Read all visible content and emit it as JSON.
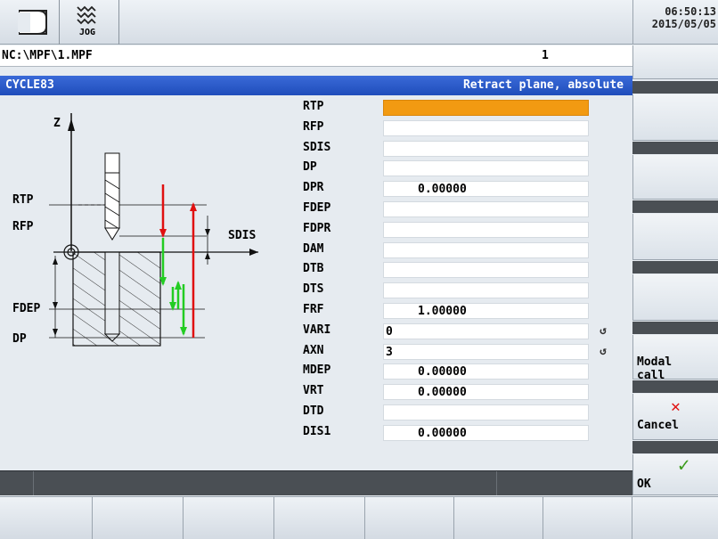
{
  "header": {
    "mode_icon": "jog-icon",
    "mode_label": "JOG",
    "time": "06:50:13",
    "date": "2015/05/05"
  },
  "path": {
    "program": "NC:\\MPF\\1.MPF",
    "channel": "1"
  },
  "cycle": {
    "name": "CYCLE83",
    "hint": "Retract plane, absolute"
  },
  "diagram": {
    "z_label": "Z",
    "rtp": "RTP",
    "rfp": "RFP",
    "sdis": "SDIS",
    "fdep": "FDEP",
    "dp": "DP"
  },
  "params": [
    {
      "name": "RTP",
      "value": "",
      "active": true
    },
    {
      "name": "RFP",
      "value": ""
    },
    {
      "name": "SDIS",
      "value": ""
    },
    {
      "name": "DP",
      "value": ""
    },
    {
      "name": "DPR",
      "value": "0.00000"
    },
    {
      "name": "FDEP",
      "value": ""
    },
    {
      "name": "FDPR",
      "value": ""
    },
    {
      "name": "DAM",
      "value": ""
    },
    {
      "name": "DTB",
      "value": ""
    },
    {
      "name": "DTS",
      "value": ""
    },
    {
      "name": "FRF",
      "value": "1.00000"
    },
    {
      "name": "VARI",
      "value": "0",
      "toggle": true
    },
    {
      "name": "AXN",
      "value": "3",
      "toggle": true
    },
    {
      "name": "MDEP",
      "value": "0.00000"
    },
    {
      "name": "VRT",
      "value": "0.00000"
    },
    {
      "name": "DTD",
      "value": ""
    },
    {
      "name": "DIS1",
      "value": "0.00000"
    }
  ],
  "softkeys": {
    "modal_call": "Modal\ncall",
    "cancel": "Cancel",
    "ok": "OK"
  },
  "colors": {
    "accent": "#f29a12",
    "title_bar": "#2a5bc9",
    "cancel_x": "#e01010",
    "ok_check": "#3a9a1a"
  }
}
